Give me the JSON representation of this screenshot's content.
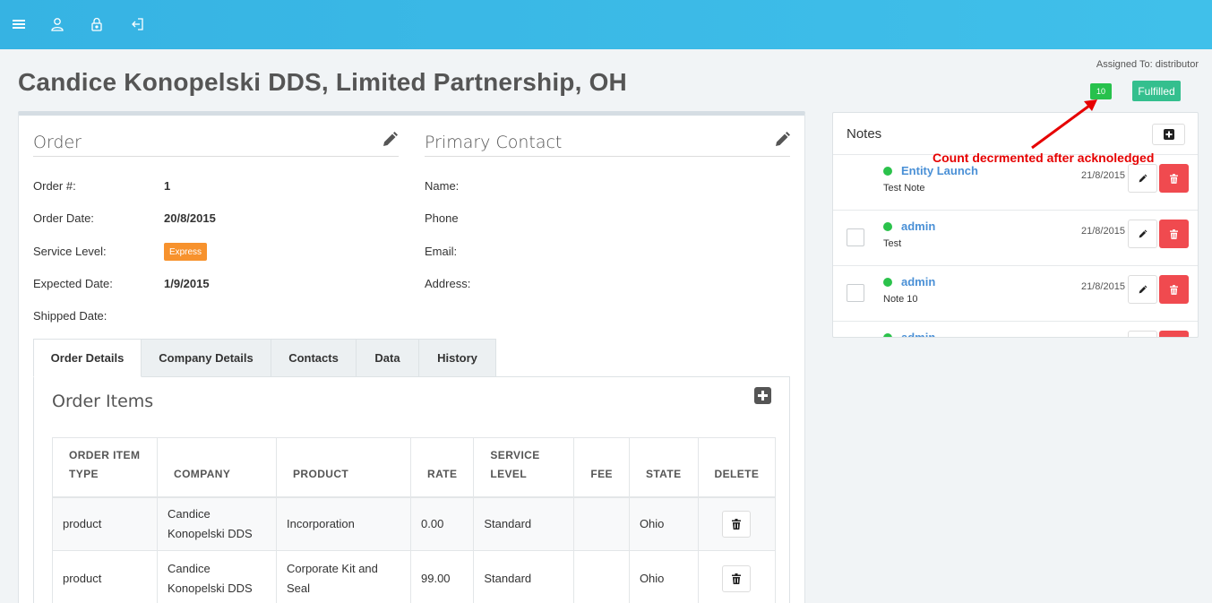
{
  "topbar": {
    "icons": [
      "menu-icon",
      "user-icon",
      "lock-icon",
      "logout-icon"
    ]
  },
  "page": {
    "title": "Candice Konopelski DDS, Limited Partnership, OH"
  },
  "header_meta": {
    "assigned_to": "Assigned To: distributor",
    "count_badge": "10",
    "status_badge": "Fulfilled"
  },
  "order": {
    "heading": "Order",
    "fields": [
      {
        "label": "Order #:",
        "value": "1"
      },
      {
        "label": "Order Date:",
        "value": "20/8/2015"
      },
      {
        "label": "Service Level:",
        "value": "Express"
      },
      {
        "label": "Expected Date:",
        "value": "1/9/2015"
      },
      {
        "label": "Shipped Date:",
        "value": ""
      }
    ]
  },
  "primary_contact": {
    "heading": "Primary Contact",
    "fields": [
      {
        "label": "Name:",
        "value": ""
      },
      {
        "label": "Phone",
        "value": ""
      },
      {
        "label": "Email:",
        "value": ""
      },
      {
        "label": "Address:",
        "value": ""
      }
    ]
  },
  "tabs": [
    {
      "label": "Order Details",
      "active": true
    },
    {
      "label": "Company Details",
      "active": false
    },
    {
      "label": "Contacts",
      "active": false
    },
    {
      "label": "Data",
      "active": false
    },
    {
      "label": "History",
      "active": false
    }
  ],
  "order_items": {
    "title": "Order Items",
    "columns": [
      [
        "ORDER ITEM",
        "TYPE"
      ],
      [
        "COMPANY"
      ],
      [
        "PRODUCT"
      ],
      [
        "RATE"
      ],
      [
        "SERVICE",
        "LEVEL"
      ],
      [
        "FEE"
      ],
      [
        "STATE"
      ],
      [
        "DELETE"
      ]
    ],
    "rows": [
      {
        "type": "product",
        "company": [
          "Candice",
          "Konopelski DDS"
        ],
        "product": [
          "Incorporation"
        ],
        "rate": "0.00",
        "service_level": "Standard",
        "fee": "",
        "state": "Ohio"
      },
      {
        "type": "product",
        "company": [
          "Candice",
          "Konopelski DDS"
        ],
        "product": [
          "Corporate Kit and",
          "Seal"
        ],
        "rate": "99.00",
        "service_level": "Standard",
        "fee": "",
        "state": "Ohio"
      }
    ]
  },
  "notes": {
    "title": "Notes",
    "items": [
      {
        "author": "Entity Launch",
        "text": "Test Note",
        "date": "21/8/2015",
        "checkbox": false
      },
      {
        "author": "admin",
        "text": "Test",
        "date": "21/8/2015",
        "checkbox": true
      },
      {
        "author": "admin",
        "text": "Note 10",
        "date": "21/8/2015",
        "checkbox": true
      },
      {
        "author": "admin",
        "text": "",
        "date": "",
        "checkbox": true
      }
    ]
  },
  "annotation": {
    "text": "Count decrmented after acknoledged",
    "color": "#e60000"
  },
  "colors": {
    "topbar": "#38b6e5",
    "count_badge": "#27c14c",
    "status_badge": "#34bf8e",
    "express_badge": "#f7922d",
    "delete_button": "#f04a4f",
    "link": "#4a90d6"
  }
}
